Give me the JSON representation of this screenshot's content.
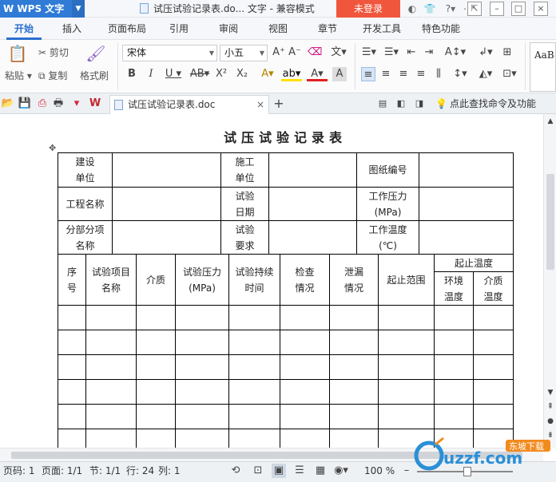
{
  "app": {
    "name": "WPS 文字",
    "login_label": "未登录"
  },
  "window": {
    "title": "试压试验记录表.do... 文字 - 兼容模式"
  },
  "menu": {
    "tabs": [
      "开始",
      "插入",
      "页面布局",
      "引用",
      "审阅",
      "视图",
      "章节",
      "开发工具",
      "特色功能"
    ],
    "active": "开始"
  },
  "ribbon": {
    "paste": "粘贴",
    "cut": "剪切",
    "copy": "复制",
    "format_painter": "格式刷",
    "font_name": "宋体",
    "font_size": "小五",
    "styles_preview": "AaB"
  },
  "doc_tab": {
    "name": "试压试验记录表.doc"
  },
  "find_command": "点此查找命令及功能",
  "document": {
    "title": "试压试验记录表",
    "header_rows": [
      [
        "建设\n单位",
        "",
        "施工\n单位",
        "",
        "图纸编号",
        ""
      ],
      [
        "工程名称",
        "",
        "试验\n日期",
        "",
        "工作压力\n(MPa)",
        ""
      ],
      [
        "分部分项\n名称",
        "",
        "试验\n要求",
        "",
        "工作温度\n(℃)",
        ""
      ]
    ],
    "columns": [
      "序\n号",
      "试验项目\n名称",
      "介质",
      "试验压力\n(MPa)",
      "试验持续\n时间",
      "检查\n情况",
      "泄漏\n情况",
      "起止范围",
      "起止温度"
    ],
    "subcolumns": [
      "环境\n温度",
      "介质\n温度"
    ]
  },
  "status": {
    "page_num": "页码: 1",
    "pages": "页面: 1/1",
    "section": "节: 1/1",
    "row": "行: 24",
    "col": "列: 1",
    "zoom": "100 %"
  },
  "watermark": "uzzf.com",
  "watermark_sub": "东坡下载",
  "colors": {
    "accent": "#2f7bd6",
    "login": "#f0563c"
  }
}
